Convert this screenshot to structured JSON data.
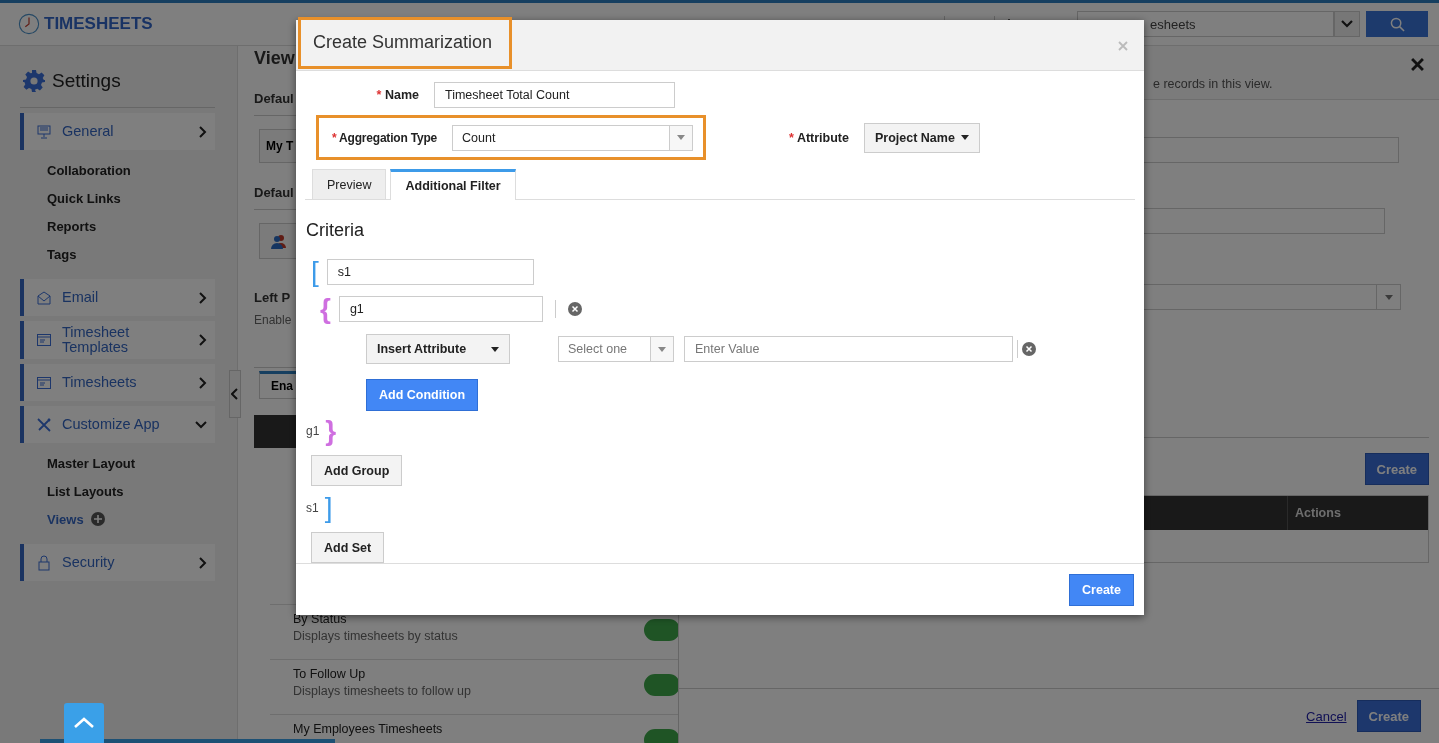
{
  "header": {
    "title": "TIMESHEETS",
    "search": {
      "placeholder": "esheets"
    }
  },
  "sidebar": {
    "title": "Settings",
    "sections": [
      {
        "label": "General",
        "expanded": false,
        "children": [
          {
            "label": "Collaboration",
            "selected": false
          },
          {
            "label": "Quick Links",
            "selected": false
          },
          {
            "label": "Reports",
            "selected": false
          },
          {
            "label": "Tags",
            "selected": false
          }
        ]
      },
      {
        "label": "Email",
        "expanded": false
      },
      {
        "label": "Timesheet Templates",
        "expanded": false
      },
      {
        "label": "Timesheets",
        "expanded": false
      },
      {
        "label": "Customize App",
        "expanded": true,
        "children": [
          {
            "label": "Master Layout",
            "selected": false
          },
          {
            "label": "List Layouts",
            "selected": false
          },
          {
            "label": "Views",
            "selected": true
          }
        ]
      },
      {
        "label": "Security",
        "expanded": false
      }
    ]
  },
  "middle": {
    "title": "View",
    "section_1": "Defaul",
    "button_1": "My T",
    "section_2": "Defaul",
    "section_3": "Left P",
    "section_3_text": "Enable",
    "tab": "Ena",
    "rows": [
      {
        "title": "By Status",
        "description": "Displays timesheets by status",
        "on": true
      },
      {
        "title": "To Follow Up",
        "description": "Displays timesheets to follow up",
        "on": true
      },
      {
        "title": "My Employees Timesheets",
        "on": true
      }
    ]
  },
  "right_panel": {
    "text": "e records in this view.",
    "create": "Create",
    "table": {
      "columns": [
        "Actions"
      ]
    },
    "cancel": "Cancel",
    "footer_create": "Create"
  },
  "modal": {
    "title": "Create Summarization",
    "name": {
      "required_mark": "*",
      "label": "Name",
      "value": "Timesheet Total Count"
    },
    "aggregation": {
      "required_mark": "*",
      "label": "Aggregation Type",
      "value": "Count"
    },
    "attribute": {
      "required_mark": "*",
      "label": "Attribute",
      "value": "Project Name"
    },
    "tabs": [
      {
        "label": "Preview",
        "selected": false
      },
      {
        "label": "Additional Filter",
        "selected": true
      }
    ],
    "criteria": {
      "title": "Criteria",
      "set": {
        "open": "[",
        "close": "]",
        "name": "s1",
        "close_label": "s1",
        "color": "#3d9be9",
        "add": "Add Set"
      },
      "group": {
        "open": "{",
        "close": "}",
        "name": "g1",
        "close_label": "g1",
        "color": "#cf6fe0",
        "add": "Add Group"
      },
      "condition": {
        "attribute": "Insert Attribute",
        "operator_placeholder": "Select one",
        "value_placeholder": "Enter Value",
        "add": "Add Condition"
      }
    },
    "create": "Create"
  }
}
